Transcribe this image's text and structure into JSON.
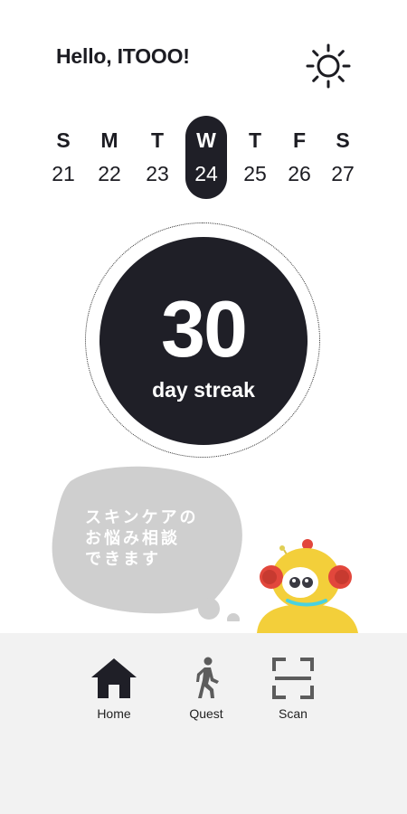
{
  "header": {
    "greeting": "Hello, ITOOO!",
    "theme_icon": "sun-icon"
  },
  "calendar": {
    "days": [
      {
        "name": "S",
        "date": "21"
      },
      {
        "name": "M",
        "date": "22"
      },
      {
        "name": "T",
        "date": "23"
      },
      {
        "name": "W",
        "date": "24",
        "active": true
      },
      {
        "name": "T",
        "date": "25"
      },
      {
        "name": "F",
        "date": "26"
      },
      {
        "name": "S",
        "date": "27"
      }
    ]
  },
  "streak": {
    "count": "30",
    "label": "day streak"
  },
  "consult": {
    "text_lines": [
      "スキンケアの",
      "お悩み相談",
      "できます"
    ],
    "mascot": "robot-mascot"
  },
  "nav": {
    "items": [
      {
        "label": "Home",
        "icon": "home-icon",
        "active": true
      },
      {
        "label": "Quest",
        "icon": "walking-person-icon"
      },
      {
        "label": "Scan",
        "icon": "scan-frame-icon"
      }
    ]
  },
  "colors": {
    "primary": "#1f1f27",
    "background": "#ffffff",
    "nav_background": "#f2f2f2",
    "bubble": "#cfcfcf",
    "mascot_yellow": "#f3cf3a",
    "mascot_red": "#e2473c"
  }
}
